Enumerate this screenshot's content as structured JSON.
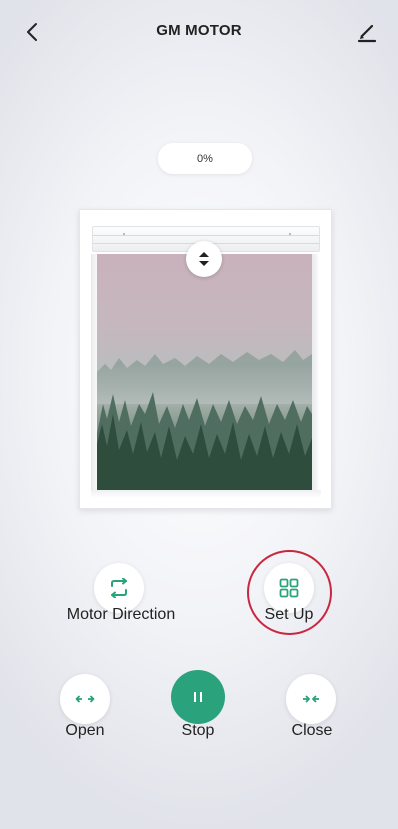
{
  "header": {
    "title": "GM MOTOR",
    "back_icon": "chevron-left-icon",
    "edit_icon": "pencil-icon"
  },
  "position": {
    "label": "0%",
    "value_percent": 0
  },
  "window": {
    "handle_icon": "up-down-arrows-icon"
  },
  "actions": {
    "motor_direction_label": "Motor Direction",
    "set_up_label": "Set Up",
    "open_label": "Open",
    "stop_label": "Stop",
    "close_label": "Close"
  },
  "colors": {
    "accent": "#2aa27c",
    "highlight_ring": "#c8283f",
    "text": "#222222"
  }
}
